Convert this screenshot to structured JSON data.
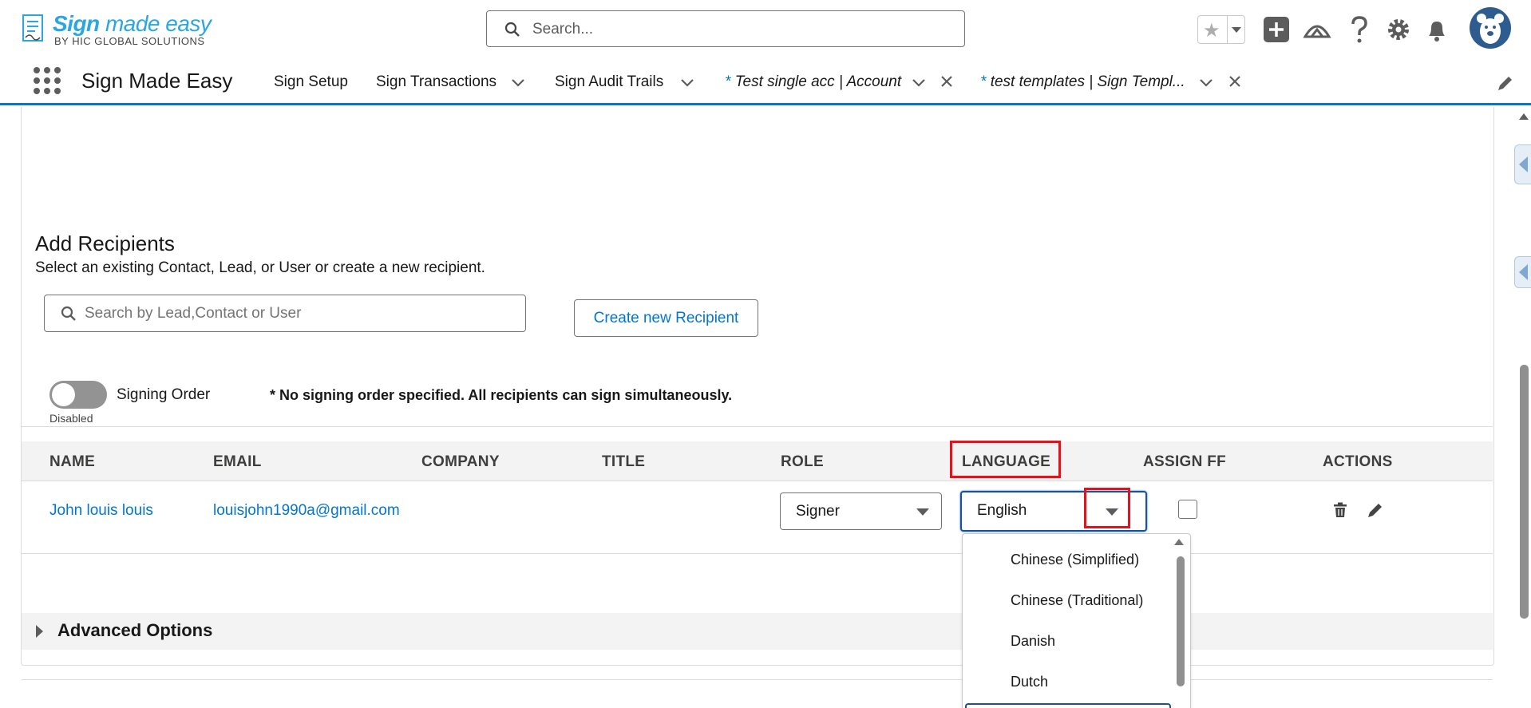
{
  "header": {
    "logo_brand": "Sign",
    "logo_brand_rest": " made easy",
    "logo_sub": "BY HIC GLOBAL SOLUTIONS",
    "search_placeholder": "Search..."
  },
  "nav": {
    "app_name": "Sign Made Easy",
    "items": [
      {
        "label": "Sign Setup"
      },
      {
        "label": "Sign Transactions"
      },
      {
        "label": "Sign Audit Trails"
      }
    ],
    "tabs": [
      {
        "prefix": "*",
        "label": "Test single acc | Account"
      },
      {
        "prefix": "*",
        "label": "test templates | Sign Templ..."
      }
    ]
  },
  "recipients": {
    "title": "Add Recipients",
    "subtitle": "Select an existing Contact, Lead, or User or create a new recipient.",
    "search_placeholder": "Search by Lead,Contact or User",
    "create_button": "Create new Recipient",
    "signing_order_label": "Signing Order",
    "signing_order_state": "Disabled",
    "signing_order_note": "* No signing order specified. All recipients can sign simultaneously.",
    "columns": [
      "NAME",
      "EMAIL",
      "COMPANY",
      "TITLE",
      "ROLE",
      "LANGUAGE",
      "ASSIGN FF",
      "ACTIONS"
    ],
    "rows": [
      {
        "name": "John louis louis",
        "email": "louisjohn1990a@gmail.com",
        "company": "",
        "title": "",
        "role": "Signer",
        "language": "English",
        "assign_ff": false
      }
    ]
  },
  "language_dropdown": {
    "options": [
      "Chinese (Simplified)",
      "Chinese (Traditional)",
      "Danish",
      "Dutch"
    ]
  },
  "advanced": {
    "label": "Advanced Options"
  },
  "colors": {
    "brand": "#0176d3",
    "annotation": "#e8101a",
    "logo": "#2aa7e0"
  }
}
